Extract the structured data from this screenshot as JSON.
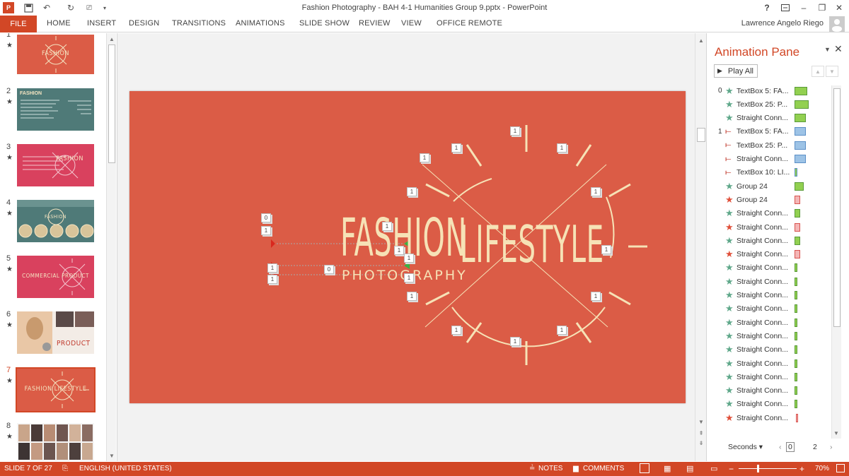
{
  "window": {
    "title": "Fashion Photography - BAH 4-1 Humanities Group 9.pptx - PowerPoint",
    "help": "?",
    "minimize": "–",
    "restore": "❐",
    "close": "✕"
  },
  "ribbon": {
    "file": "FILE",
    "tabs": [
      "HOME",
      "INSERT",
      "DESIGN",
      "TRANSITIONS",
      "ANIMATIONS",
      "SLIDE SHOW",
      "REVIEW",
      "VIEW",
      "OFFICE REMOTE"
    ],
    "user": "Lawrence Angelo Riego"
  },
  "thumbnails": [
    {
      "num": "1",
      "label": "FASHION"
    },
    {
      "num": "2",
      "label": "FASHION"
    },
    {
      "num": "3",
      "label": "FASHION"
    },
    {
      "num": "4",
      "label": "FASHION"
    },
    {
      "num": "5",
      "label": "COMMERCIAL PRODUCT"
    },
    {
      "num": "6",
      "label": "PRODUCT"
    },
    {
      "num": "7",
      "label": "FASHION LIFESTYLE"
    },
    {
      "num": "8",
      "label": ""
    }
  ],
  "slide": {
    "word1": "FASHION",
    "word2": "LIFESTYLE",
    "subtitle": "PHOTOGRAPHY"
  },
  "anim_pane": {
    "title": "Animation Pane",
    "play_all": "Play All",
    "items": [
      {
        "num": "0",
        "label": "TextBox 5: FA...",
        "effect": "entrance",
        "bar_color": "#92d050"
      },
      {
        "num": "",
        "label": "TextBox 25: P...",
        "effect": "entrance",
        "bar_color": "#92d050"
      },
      {
        "num": "",
        "label": "Straight Conn...",
        "effect": "entrance",
        "bar_color": "#92d050"
      },
      {
        "num": "1",
        "label": "TextBox 5: FA...",
        "effect": "motion",
        "bar_color": "#9dc3e6"
      },
      {
        "num": "",
        "label": "TextBox 25: P...",
        "effect": "motion",
        "bar_color": "#9dc3e6"
      },
      {
        "num": "",
        "label": "Straight Conn...",
        "effect": "motion",
        "bar_color": "#9dc3e6"
      },
      {
        "num": "",
        "label": "TextBox 10: LI...",
        "effect": "motion",
        "bar_color": "#92d050"
      },
      {
        "num": "",
        "label": "Group 24",
        "effect": "entrance",
        "bar_color": "#92d050"
      },
      {
        "num": "",
        "label": "Group 24",
        "effect": "exit",
        "bar_color": "#f4b6b6"
      },
      {
        "num": "",
        "label": "Straight Conn...",
        "effect": "entrance",
        "bar_color": "#92d050"
      },
      {
        "num": "",
        "label": "Straight Conn...",
        "effect": "exit",
        "bar_color": "#f4b6b6"
      },
      {
        "num": "",
        "label": "Straight Conn...",
        "effect": "entrance",
        "bar_color": "#92d050"
      },
      {
        "num": "",
        "label": "Straight Conn...",
        "effect": "exit",
        "bar_color": "#f4b6b6"
      },
      {
        "num": "",
        "label": "Straight Conn...",
        "effect": "entrance",
        "bar_color": "#92d050"
      },
      {
        "num": "",
        "label": "Straight Conn...",
        "effect": "entrance",
        "bar_color": "#92d050"
      },
      {
        "num": "",
        "label": "Straight Conn...",
        "effect": "entrance",
        "bar_color": "#92d050"
      },
      {
        "num": "",
        "label": "Straight Conn...",
        "effect": "entrance",
        "bar_color": "#92d050"
      },
      {
        "num": "",
        "label": "Straight Conn...",
        "effect": "entrance",
        "bar_color": "#92d050"
      },
      {
        "num": "",
        "label": "Straight Conn...",
        "effect": "entrance",
        "bar_color": "#92d050"
      },
      {
        "num": "",
        "label": "Straight Conn...",
        "effect": "entrance",
        "bar_color": "#92d050"
      },
      {
        "num": "",
        "label": "Straight Conn...",
        "effect": "entrance",
        "bar_color": "#92d050"
      },
      {
        "num": "",
        "label": "Straight Conn...",
        "effect": "entrance",
        "bar_color": "#92d050"
      },
      {
        "num": "",
        "label": "Straight Conn...",
        "effect": "entrance",
        "bar_color": "#92d050"
      },
      {
        "num": "",
        "label": "Straight Conn...",
        "effect": "entrance",
        "bar_color": "#92d050"
      },
      {
        "num": "",
        "label": "Straight Conn...",
        "effect": "exit",
        "bar_color": "#f4b6b6"
      }
    ],
    "seconds_label": "Seconds",
    "timeline_start": "0",
    "timeline_end": "2"
  },
  "statusbar": {
    "slide": "SLIDE 7 OF 27",
    "language": "ENGLISH (UNITED STATES)",
    "notes": "NOTES",
    "comments": "COMMENTS",
    "zoom": "70%"
  },
  "colors": {
    "accent": "#d24726",
    "slide_bg": "#db5c46",
    "slide_text": "#f6e2b6",
    "entrance_star": "#5fa88a",
    "exit_star": "#e0503a"
  }
}
